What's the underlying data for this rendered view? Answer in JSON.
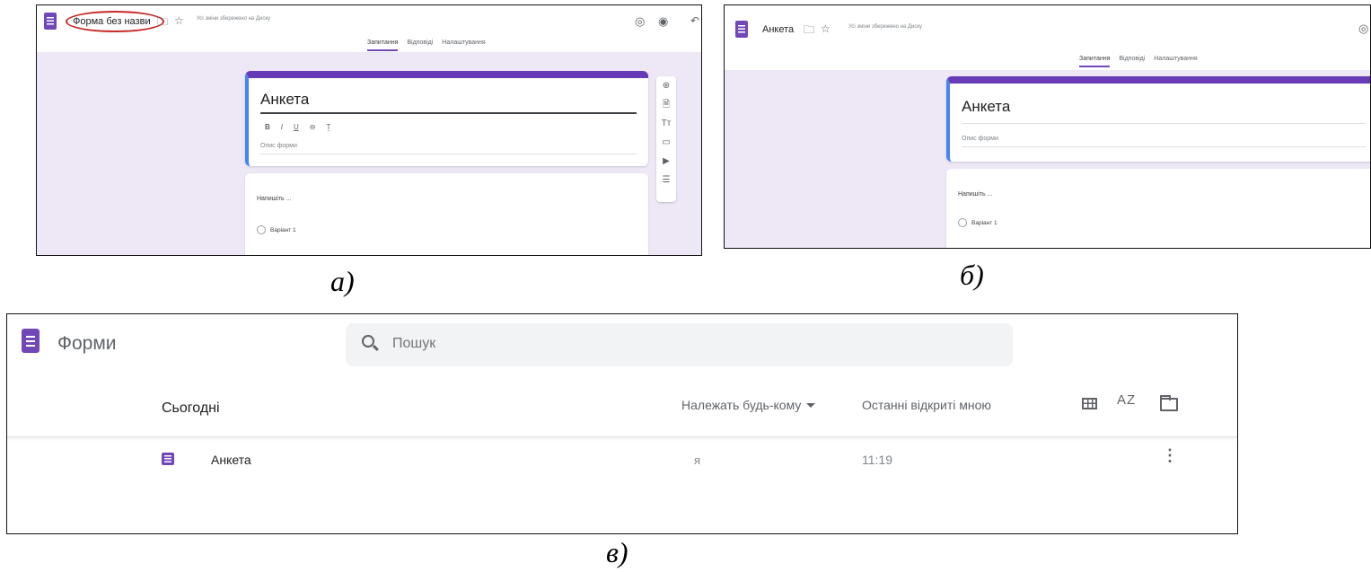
{
  "screenshot_a": {
    "doc_title": "Форма без назви",
    "saved_note": "Усі зміни збережено на Диску",
    "tabs": [
      "Запитання",
      "Відповіді",
      "Налаштування"
    ],
    "form_title": "Анкета",
    "format_buttons": [
      "B",
      "I",
      "U",
      "⊖",
      "Ṯ"
    ],
    "form_description_placeholder": "Опис форми",
    "question_placeholder": "Напишіть ...",
    "option_label": "Варіант 1",
    "side_tools": [
      "⊕",
      "🗎",
      "Tт",
      "▭",
      "▶",
      "☰"
    ],
    "caption": "а)"
  },
  "screenshot_b": {
    "doc_title": "Анкета",
    "saved_note": "Усі зміни збережено на Диску",
    "tabs": [
      "Запитання",
      "Відповіді",
      "Налаштування"
    ],
    "form_title": "Анкета",
    "form_description_placeholder": "Опис форми",
    "question_placeholder": "Напишіть ...",
    "option_label": "Варіант 1",
    "caption": "б)"
  },
  "screenshot_c": {
    "app_name": "Форми",
    "search_placeholder": "Пошук",
    "section_label": "Сьогодні",
    "owner_filter": "Належать будь-кому",
    "sort_label": "Останні відкриті мною",
    "sort_icon_text": "AZ",
    "rows": [
      {
        "name": "Анкета",
        "owner": "я",
        "time": "11:19"
      }
    ],
    "caption": "в)"
  },
  "colors": {
    "forms_purple": "#7248b9",
    "header_accent": "#673ab7",
    "canvas_bg": "#ede7f6",
    "annotation_red": "#c62828"
  }
}
